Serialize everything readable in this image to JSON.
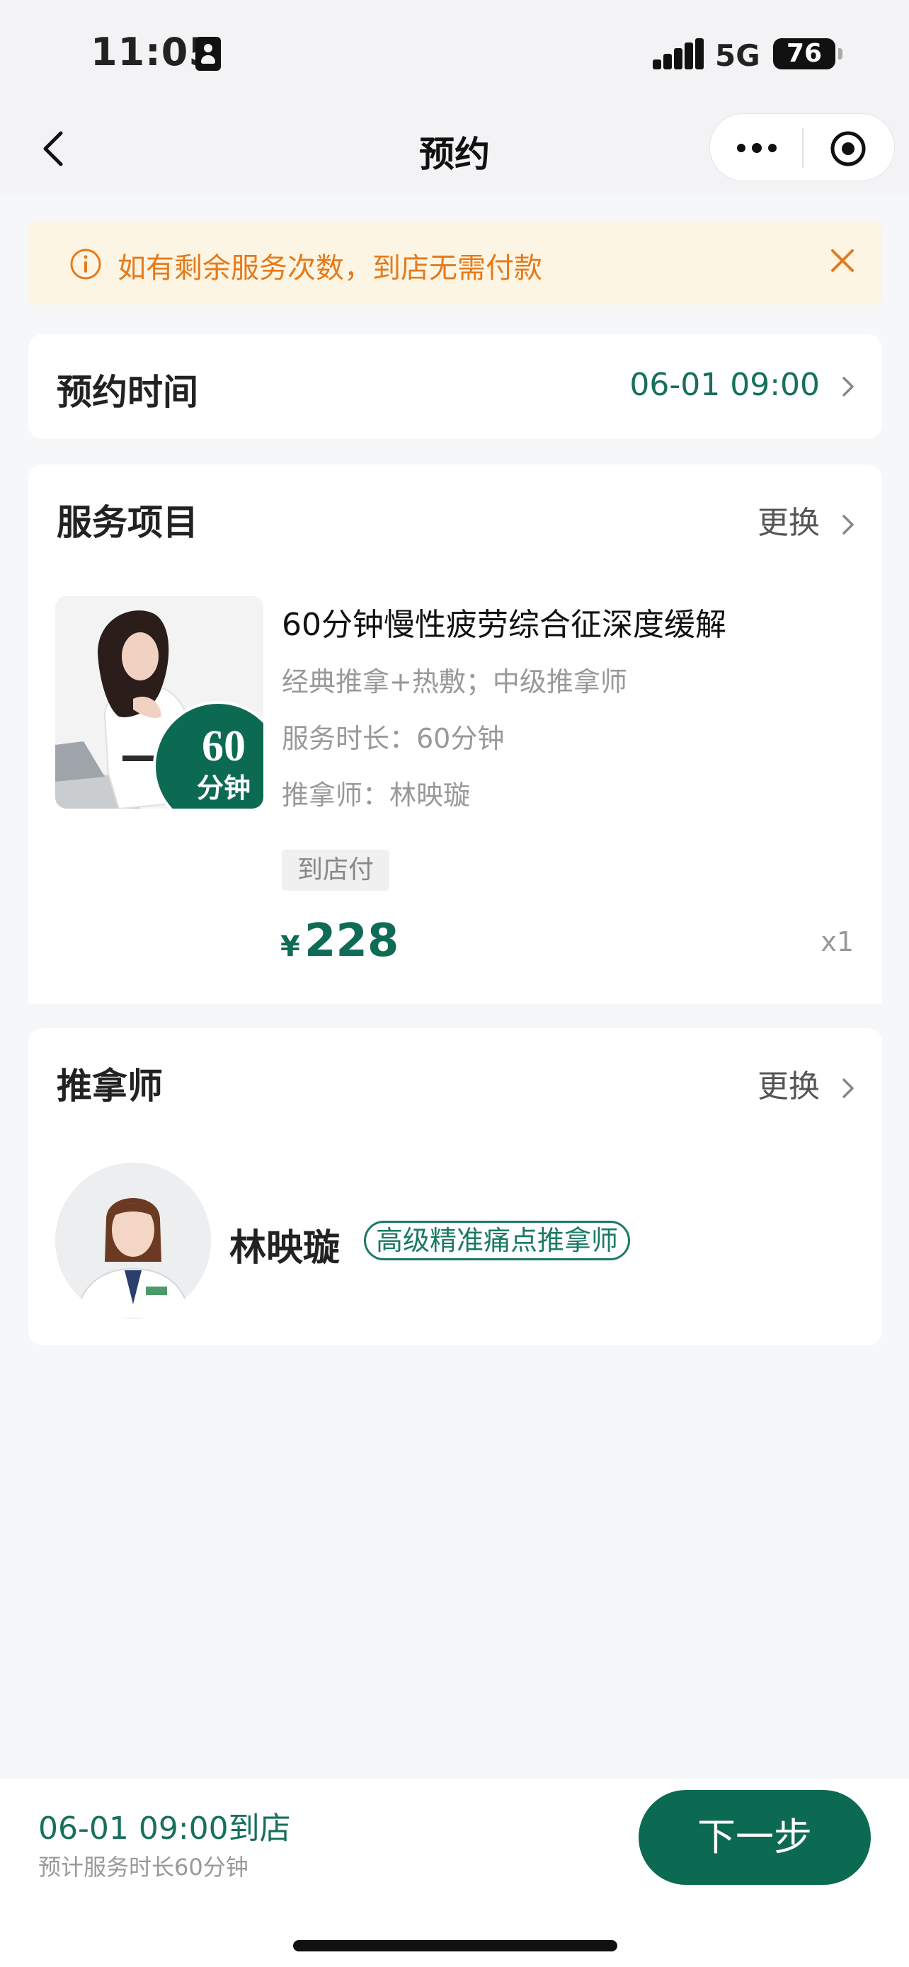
{
  "status_bar": {
    "time": "11:05",
    "network": "5G",
    "battery": "76"
  },
  "nav": {
    "title": "预约"
  },
  "notice": {
    "text": "如有剩余服务次数，到店无需付款"
  },
  "appointment_time": {
    "label": "预约时间",
    "value": "06-01 09:00"
  },
  "service": {
    "section_title": "服务项目",
    "change_label": "更换",
    "badge_number": "60",
    "badge_unit": "分钟",
    "name": "60分钟慢性疲劳综合征深度缓解",
    "desc": "经典推拿+热敷；中级推拿师",
    "duration": "服务时长：60分钟",
    "therapist": "推拿师：林映璇",
    "pay_tag": "到店付",
    "currency": "¥",
    "price": "228",
    "quantity": "x1"
  },
  "therapist": {
    "section_title": "推拿师",
    "change_label": "更换",
    "name": "林映璇",
    "title_badge": "高级精准痛点推拿师"
  },
  "bottom": {
    "arrival": "06-01 09:00到店",
    "estimate": "预计服务时长60分钟",
    "next_label": "下一步"
  },
  "colors": {
    "brand": "#0c6a53",
    "notice_bg": "#fdf5e3",
    "notice_text": "#e57a1c"
  }
}
